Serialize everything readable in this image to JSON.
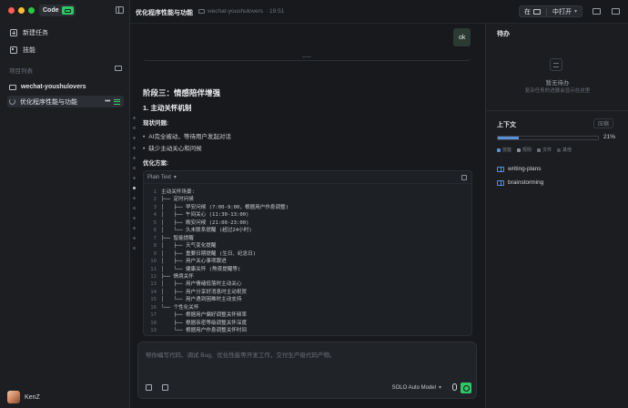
{
  "app": {
    "brand": "Code"
  },
  "sidebar": {
    "nav": [
      {
        "label": "新建任务",
        "icon": "new-task-icon"
      },
      {
        "label": "技能",
        "icon": "skills-icon"
      }
    ],
    "section_label": "项目列表",
    "project": {
      "name": "wechat-youshulovers",
      "task": "优化程序性能与功能"
    },
    "user": {
      "name": "KenZ"
    }
  },
  "header": {
    "title": "优化程序性能与功能",
    "folder": "wechat-youshulovers",
    "time": "· 19:51",
    "open_in_prefix": "在",
    "open_in_label": "中打开"
  },
  "chat": {
    "user_message": "ok",
    "heading": "阶段三：情感陪伴增强",
    "subheading": "1. 主动关怀机制",
    "problem_label": "现状问题:",
    "problems": [
      "AI完全被动，等待用户发起对话",
      "缺少主动关心和问候"
    ],
    "solution_label": "优化方案:",
    "code_lang": "Plain Text",
    "code_lines": [
      {
        "n": "1",
        "t": "主动关怀场景:"
      },
      {
        "n": "2",
        "t": "├── 定时问候"
      },
      {
        "n": "3",
        "t": "│   ├── 早安问候 (7:00-9:00，根据用户作息调整)"
      },
      {
        "n": "4",
        "t": "│   ├── 午间关心 (11:30-13:00)"
      },
      {
        "n": "5",
        "t": "│   ├── 晚安问候 (21:00-23:00)"
      },
      {
        "n": "6",
        "t": "│   └── 久未联系提醒 (超过24小时)"
      },
      {
        "n": "7",
        "t": "├── 智能提醒"
      },
      {
        "n": "8",
        "t": "│   ├── 天气变化提醒"
      },
      {
        "n": "9",
        "t": "│   ├── 重要日期提醒 (生日、纪念日)"
      },
      {
        "n": "10",
        "t": "│   ├── 用户关心事项跟进"
      },
      {
        "n": "11",
        "t": "│   └── 健康关怀 (熬夜提醒等)"
      },
      {
        "n": "12",
        "t": "├── 情境关怀"
      },
      {
        "n": "13",
        "t": "│   ├── 用户情绪低落时主动关心"
      },
      {
        "n": "14",
        "t": "│   ├── 用户分享好消息时主动祝贺"
      },
      {
        "n": "15",
        "t": "│   └── 用户遇到困难时主动支持"
      },
      {
        "n": "16",
        "t": "└── 个性化关怀"
      },
      {
        "n": "17",
        "t": "    ├── 根据用户偏好调整关怀频率"
      },
      {
        "n": "18",
        "t": "    ├── 根据亲密等级调整关怀深度"
      },
      {
        "n": "19",
        "t": "    └── 根据用户作息调整关怀时间"
      }
    ],
    "composer_placeholder": "帮你编写代码、调试 Bug、优化性能等开发工作，交付生产级代码产物。",
    "model_label": "SOLO Auto Model"
  },
  "panel": {
    "todo_title": "待办",
    "todo_empty_title": "暂无待办",
    "todo_empty_sub": "复杂任务的进展会显示在这里",
    "context_title": "上下文",
    "compress_label": "压缩",
    "context_usage_fraction": 0.21,
    "context_percent": "21%",
    "legend": [
      {
        "label": "技能",
        "color": "#5b8fd6"
      },
      {
        "label": "规则",
        "color": "#8a8f97"
      },
      {
        "label": "文件",
        "color": "#6c7078"
      },
      {
        "label": "其他",
        "color": "#4a4e55"
      }
    ],
    "skills": [
      "writing-plans",
      "brainstorming"
    ]
  },
  "colors": {
    "accent": "#32c766",
    "bg": "#17191c",
    "sidebar": "#1c1e22",
    "context_bar": "#5b8fd6"
  }
}
